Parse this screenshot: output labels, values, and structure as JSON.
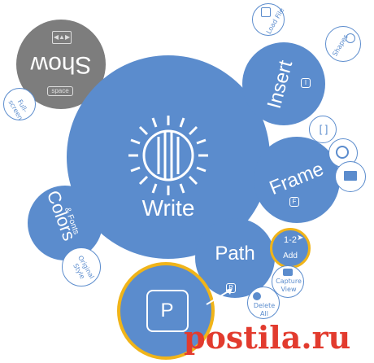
{
  "zui": {
    "center": {
      "label": "Write"
    },
    "show": {
      "label": "Show",
      "key": "space"
    },
    "insert": {
      "label": "Insert",
      "key": "I",
      "shapes_label": "Shapes",
      "load_label": "Load File"
    },
    "frame": {
      "label": "Frame",
      "key": "F"
    },
    "path": {
      "label": "Path",
      "key": "P"
    },
    "colors": {
      "label": "Colors",
      "sub_label": "& Fonts",
      "original_style_label": "Original Style"
    },
    "fullscreen_label": "Full-screen",
    "add": {
      "label": "Add",
      "ordinal": "1-2"
    },
    "capture_view_label": "Capture View",
    "delete_label": "Delete All",
    "zoom_key": "P"
  },
  "watermark": {
    "text": "postila.ru"
  },
  "colors": {
    "accent": "#5b8ccd",
    "show_bubble": "#7d7d7d",
    "highlight": "#f0b419",
    "watermark": "#e23b2e"
  }
}
